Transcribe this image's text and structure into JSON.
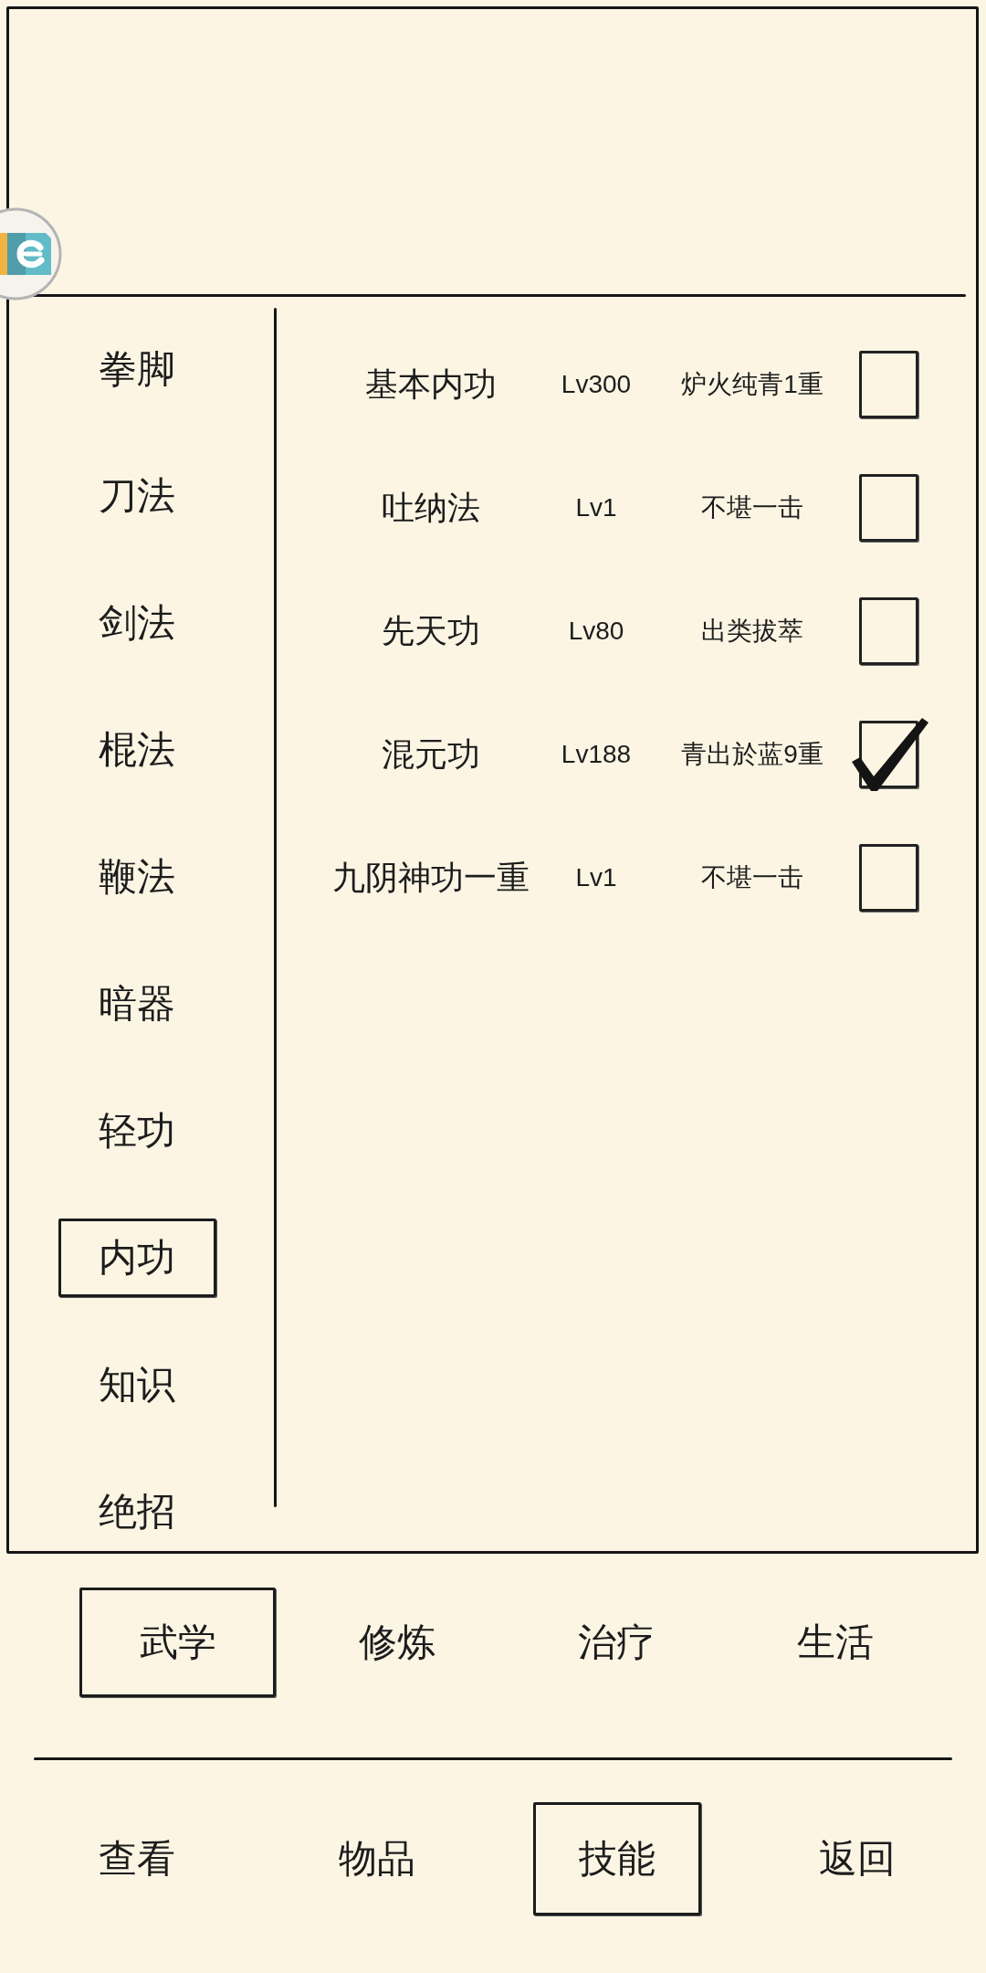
{
  "categories": [
    {
      "label": "拳脚",
      "selected": false
    },
    {
      "label": "刀法",
      "selected": false
    },
    {
      "label": "剑法",
      "selected": false
    },
    {
      "label": "棍法",
      "selected": false
    },
    {
      "label": "鞭法",
      "selected": false
    },
    {
      "label": "暗器",
      "selected": false
    },
    {
      "label": "轻功",
      "selected": false
    },
    {
      "label": "内功",
      "selected": true
    },
    {
      "label": "知识",
      "selected": false
    },
    {
      "label": "绝招",
      "selected": false
    }
  ],
  "skills": [
    {
      "name": "基本内功",
      "lv": "Lv300",
      "grade": "炉火纯青1重",
      "checked": false
    },
    {
      "name": "吐纳法",
      "lv": "Lv1",
      "grade": "不堪一击",
      "checked": false
    },
    {
      "name": "先天功",
      "lv": "Lv80",
      "grade": "出类拔萃",
      "checked": false
    },
    {
      "name": "混元功",
      "lv": "Lv188",
      "grade": "青出於蓝9重",
      "checked": true
    },
    {
      "name": "九阴神功一重",
      "lv": "Lv1",
      "grade": "不堪一击",
      "checked": false
    }
  ],
  "tabs": [
    {
      "label": "武学",
      "selected": true
    },
    {
      "label": "修炼",
      "selected": false
    },
    {
      "label": "治疗",
      "selected": false
    },
    {
      "label": "生活",
      "selected": false
    }
  ],
  "nav": [
    {
      "label": "查看",
      "selected": false
    },
    {
      "label": "物品",
      "selected": false
    },
    {
      "label": "技能",
      "selected": true
    },
    {
      "label": "返回",
      "selected": false
    }
  ]
}
